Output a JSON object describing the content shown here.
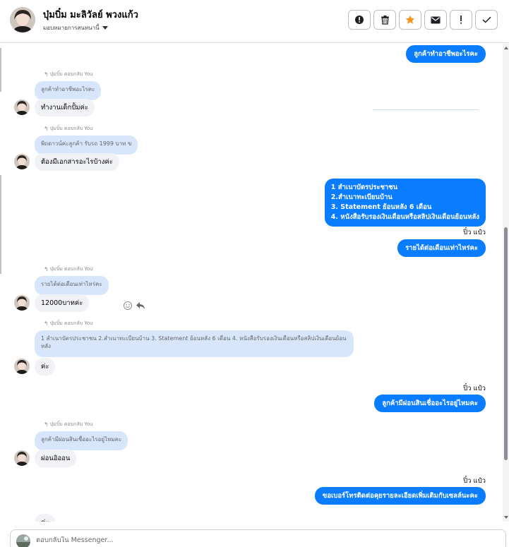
{
  "header": {
    "contact_name": "บุ๋มบิ๋ม มะลิวัลย์ พวงแก้ว",
    "assign_label": "มอบหมายการสนทนานี้",
    "toolbar": [
      {
        "name": "report-button",
        "icon": "exclamation-circle-icon"
      },
      {
        "name": "delete-button",
        "icon": "trash-icon"
      },
      {
        "name": "star-button",
        "icon": "star-icon",
        "color": "#f7931e"
      },
      {
        "name": "mark-unread-button",
        "icon": "envelope-icon"
      },
      {
        "name": "follow-up-button",
        "icon": "exclamation-icon"
      },
      {
        "name": "mark-done-button",
        "icon": "check-icon"
      }
    ]
  },
  "colors": {
    "outgoing_bubble": "#0a7cff",
    "incoming_bubble": "#f0f2f5",
    "quoted_bubble": "#d7e6fb"
  },
  "messages": {
    "m1_out": "ลูกค้าทำอาชีพอะไรคะ",
    "m2_reply_label": "บุ๋มบิ๋ม ตอบกลับ You",
    "m2_quote": "ลูกค้าทำอาชีพอะไรคะ",
    "m2_text": "ทำงานเด็กปั้มค่ะ",
    "m3_reply_label": "บุ๋มบิ๋ม ตอบกลับ You",
    "m3_quote": "พิถดาวน์ค่ะลูกค้า รับรถ 1999 บาท ข",
    "m3_text": "ต้องมีเอกสารอะไรบ้างค่ะ",
    "m4_out": "1 สำเนาบัตรประชาชน\n2.สำเนาทะเบียนบ้าน\n 3. Statement ย้อนหลัง 6 เดือน\n4. หนังสือรับรองเงินเดือนหรือสลิปเงินเดือนย้อนหลัง",
    "m5_sender": "ปิ๋ว แป๋ว",
    "m5_out": "รายได้ต่อเดือนเท่าไหร่คะ",
    "m6_reply_label": "บุ๋มบิ๋ม ตอบกลับ You",
    "m6_quote": "รายได้ต่อเดือนเท่าไหร่คะ",
    "m6_text": "12000บาทค่ะ",
    "m7_reply_label": "บุ๋มบิ๋ม ตอบกลับ You",
    "m7_quote": "1 สำเนาบัตรประชาชน 2.สำเนาทะเบียนบ้าน 3. Statement ย้อนหลัง 6 เดือน 4. หนังสือรับรองเงินเดือนหรือสลิปเงินเดือนย้อนหลัง",
    "m7_text": "ค่ะ",
    "m8_sender": "ปิ๋ว แป๋ว",
    "m8_out": "ลูกค้ามีผ่อนสินเชื่ออะไรอยู่ไหมคะ",
    "m9_reply_label": "บุ๋มบิ๋ม ตอบกลับ You",
    "m9_quote": "ลูกค้ามีผ่อนสินเชื่ออะไรอยู่ไหมคะ",
    "m9_text": "ผ่อนอิออน",
    "m10_sender": "ปิ๋ว แป๋ว",
    "m10_out": "ขอเบอร์โทรติดต่อคุยรายละเอียดเพิ่มเติมกับเซลล์นะคะ",
    "m11_text": "ค่ะ"
  },
  "composer": {
    "placeholder": "ตอบกลับใน Messenger..."
  }
}
